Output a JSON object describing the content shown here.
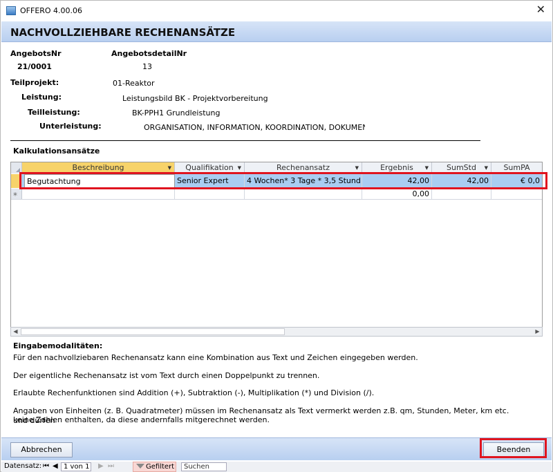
{
  "window": {
    "title": "OFFERO 4.00.06",
    "close_glyph": "✕"
  },
  "header": {
    "title": "NACHVOLLZIEHBARE RECHENANSÄTZE"
  },
  "fields": {
    "angebotsnr_label": "AngebotsNr",
    "angebotsnr_value": "21/0001",
    "angebotsdetailnr_label": "AngebotsdetailNr",
    "angebotsdetailnr_value": "13",
    "teilprojekt_label": "Teilprojekt:",
    "teilprojekt_value": "01-Reaktor",
    "leistung_label": "Leistung:",
    "leistung_value": "Leistungsbild BK - Projektvorbereitung",
    "teilleistung_label": "Teilleistung:",
    "teilleistung_value": "BK-PPH1 Grundleistung",
    "unterleistung_label": "Unterleistung:",
    "unterleistung_value": "ORGANISATION, INFORMATION, KOORDINATION, DOKUMENT/"
  },
  "section": {
    "kalkulation_title": "Kalkulationsansätze"
  },
  "grid": {
    "columns": [
      "Beschreibung",
      "Qualifikation",
      "Rechenansatz",
      "Ergebnis",
      "SumStd",
      "SumPA"
    ],
    "dropdown_glyph": "▼",
    "rows": [
      {
        "beschreibung": "Begutachtung",
        "qualifikation": "Senior Expert",
        "rechenansatz": "4 Wochen* 3 Tage * 3,5 Stund",
        "ergebnis": "42,00",
        "sumstd": "42,00",
        "sumpa": "€ 0,0"
      }
    ],
    "new_row": {
      "marker": "*",
      "ergebnis": "0,00"
    }
  },
  "info": {
    "title": "Eingabemodalitäten:",
    "lines": [
      "Für den nachvollziebaren Rechenansatz kann eine Kombination aus Text und Zeichen eingegeben werden.",
      "Der eigentliche Rechenansatz ist vom Text durch einen Doppelpunkt zu trennen.",
      "Erlaubte Rechenfunktionen sind Addition (+), Subtraktion (-), Multiplikation (*) und Division (/).",
      "Angaben von Einheiten (z. B. Quadratmeter) müssen im Rechenansatz als Text vermerkt werden z.B. qm, Stunden, Meter, km etc. und dürfen",
      "keine Zahlen enthalten, da diese andernfalls mitgerechnet werden."
    ]
  },
  "buttons": {
    "cancel": "Abbrechen",
    "finish": "Beenden"
  },
  "navigation": {
    "label": "Datensatz:",
    "first": "⏮",
    "prev": "◀",
    "position": "1 von 1",
    "next": "▶",
    "last": "⏭",
    "filter": "Gefiltert",
    "search_placeholder": "Suchen"
  },
  "colors": {
    "header_band": "#c4d7f3",
    "selected_row": "#a9cdf2",
    "selected_header": "#f7d36a",
    "highlight_box": "#e0141f"
  }
}
